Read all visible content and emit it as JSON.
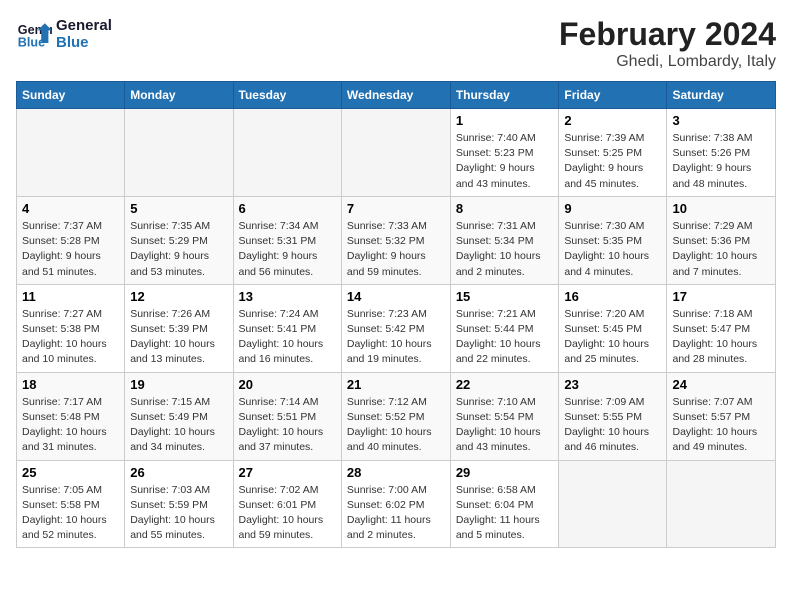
{
  "header": {
    "logo_line1": "General",
    "logo_line2": "Blue",
    "main_title": "February 2024",
    "subtitle": "Ghedi, Lombardy, Italy"
  },
  "columns": [
    "Sunday",
    "Monday",
    "Tuesday",
    "Wednesday",
    "Thursday",
    "Friday",
    "Saturday"
  ],
  "weeks": [
    [
      {
        "day": "",
        "info": ""
      },
      {
        "day": "",
        "info": ""
      },
      {
        "day": "",
        "info": ""
      },
      {
        "day": "",
        "info": ""
      },
      {
        "day": "1",
        "info": "Sunrise: 7:40 AM\nSunset: 5:23 PM\nDaylight: 9 hours\nand 43 minutes."
      },
      {
        "day": "2",
        "info": "Sunrise: 7:39 AM\nSunset: 5:25 PM\nDaylight: 9 hours\nand 45 minutes."
      },
      {
        "day": "3",
        "info": "Sunrise: 7:38 AM\nSunset: 5:26 PM\nDaylight: 9 hours\nand 48 minutes."
      }
    ],
    [
      {
        "day": "4",
        "info": "Sunrise: 7:37 AM\nSunset: 5:28 PM\nDaylight: 9 hours\nand 51 minutes."
      },
      {
        "day": "5",
        "info": "Sunrise: 7:35 AM\nSunset: 5:29 PM\nDaylight: 9 hours\nand 53 minutes."
      },
      {
        "day": "6",
        "info": "Sunrise: 7:34 AM\nSunset: 5:31 PM\nDaylight: 9 hours\nand 56 minutes."
      },
      {
        "day": "7",
        "info": "Sunrise: 7:33 AM\nSunset: 5:32 PM\nDaylight: 9 hours\nand 59 minutes."
      },
      {
        "day": "8",
        "info": "Sunrise: 7:31 AM\nSunset: 5:34 PM\nDaylight: 10 hours\nand 2 minutes."
      },
      {
        "day": "9",
        "info": "Sunrise: 7:30 AM\nSunset: 5:35 PM\nDaylight: 10 hours\nand 4 minutes."
      },
      {
        "day": "10",
        "info": "Sunrise: 7:29 AM\nSunset: 5:36 PM\nDaylight: 10 hours\nand 7 minutes."
      }
    ],
    [
      {
        "day": "11",
        "info": "Sunrise: 7:27 AM\nSunset: 5:38 PM\nDaylight: 10 hours\nand 10 minutes."
      },
      {
        "day": "12",
        "info": "Sunrise: 7:26 AM\nSunset: 5:39 PM\nDaylight: 10 hours\nand 13 minutes."
      },
      {
        "day": "13",
        "info": "Sunrise: 7:24 AM\nSunset: 5:41 PM\nDaylight: 10 hours\nand 16 minutes."
      },
      {
        "day": "14",
        "info": "Sunrise: 7:23 AM\nSunset: 5:42 PM\nDaylight: 10 hours\nand 19 minutes."
      },
      {
        "day": "15",
        "info": "Sunrise: 7:21 AM\nSunset: 5:44 PM\nDaylight: 10 hours\nand 22 minutes."
      },
      {
        "day": "16",
        "info": "Sunrise: 7:20 AM\nSunset: 5:45 PM\nDaylight: 10 hours\nand 25 minutes."
      },
      {
        "day": "17",
        "info": "Sunrise: 7:18 AM\nSunset: 5:47 PM\nDaylight: 10 hours\nand 28 minutes."
      }
    ],
    [
      {
        "day": "18",
        "info": "Sunrise: 7:17 AM\nSunset: 5:48 PM\nDaylight: 10 hours\nand 31 minutes."
      },
      {
        "day": "19",
        "info": "Sunrise: 7:15 AM\nSunset: 5:49 PM\nDaylight: 10 hours\nand 34 minutes."
      },
      {
        "day": "20",
        "info": "Sunrise: 7:14 AM\nSunset: 5:51 PM\nDaylight: 10 hours\nand 37 minutes."
      },
      {
        "day": "21",
        "info": "Sunrise: 7:12 AM\nSunset: 5:52 PM\nDaylight: 10 hours\nand 40 minutes."
      },
      {
        "day": "22",
        "info": "Sunrise: 7:10 AM\nSunset: 5:54 PM\nDaylight: 10 hours\nand 43 minutes."
      },
      {
        "day": "23",
        "info": "Sunrise: 7:09 AM\nSunset: 5:55 PM\nDaylight: 10 hours\nand 46 minutes."
      },
      {
        "day": "24",
        "info": "Sunrise: 7:07 AM\nSunset: 5:57 PM\nDaylight: 10 hours\nand 49 minutes."
      }
    ],
    [
      {
        "day": "25",
        "info": "Sunrise: 7:05 AM\nSunset: 5:58 PM\nDaylight: 10 hours\nand 52 minutes."
      },
      {
        "day": "26",
        "info": "Sunrise: 7:03 AM\nSunset: 5:59 PM\nDaylight: 10 hours\nand 55 minutes."
      },
      {
        "day": "27",
        "info": "Sunrise: 7:02 AM\nSunset: 6:01 PM\nDaylight: 10 hours\nand 59 minutes."
      },
      {
        "day": "28",
        "info": "Sunrise: 7:00 AM\nSunset: 6:02 PM\nDaylight: 11 hours\nand 2 minutes."
      },
      {
        "day": "29",
        "info": "Sunrise: 6:58 AM\nSunset: 6:04 PM\nDaylight: 11 hours\nand 5 minutes."
      },
      {
        "day": "",
        "info": ""
      },
      {
        "day": "",
        "info": ""
      }
    ]
  ]
}
